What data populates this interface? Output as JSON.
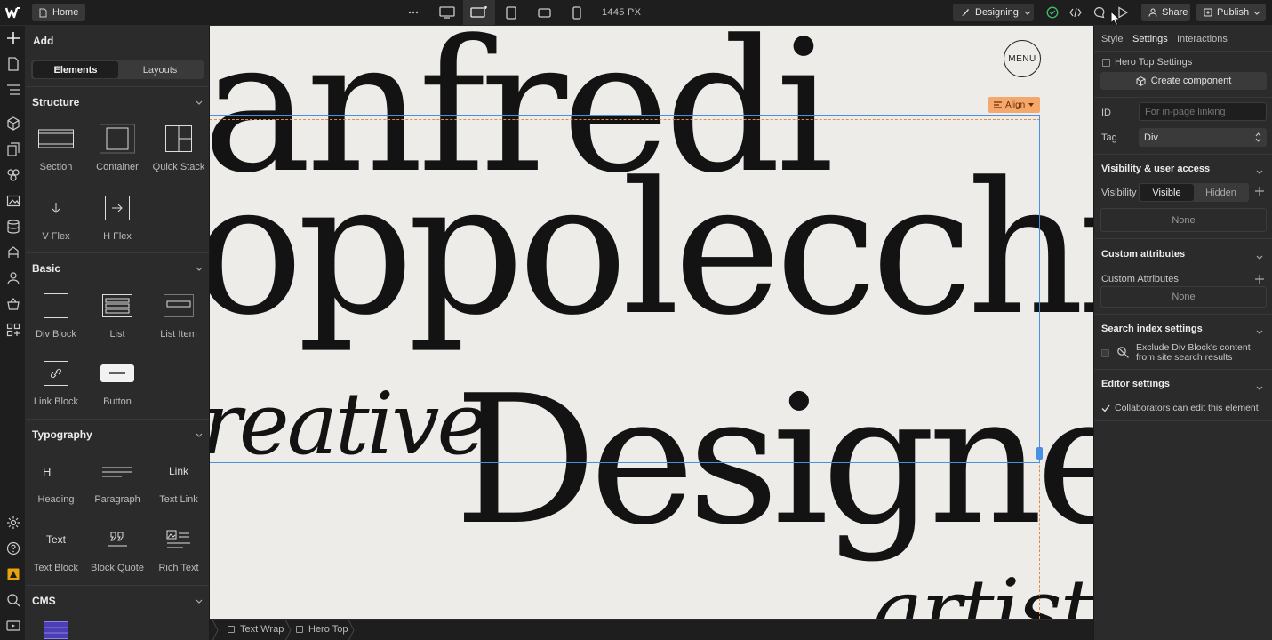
{
  "topbar": {
    "home_label": "Home",
    "width_label": "1445 PX",
    "mode_label": "Designing",
    "share_label": "Share",
    "publish_label": "Publish"
  },
  "add_panel": {
    "title": "Add",
    "tabs": [
      "Elements",
      "Layouts"
    ],
    "sections": {
      "structure": {
        "title": "Structure",
        "items": [
          "Section",
          "Container",
          "Quick Stack",
          "V Flex",
          "H Flex"
        ]
      },
      "basic": {
        "title": "Basic",
        "items": [
          "Div Block",
          "List",
          "List Item",
          "Link Block",
          "Button"
        ]
      },
      "typography": {
        "title": "Typography",
        "items": [
          "Heading",
          "Paragraph",
          "Text Link",
          "Text Block",
          "Block Quote",
          "Rich Text"
        ]
      },
      "cms": {
        "title": "CMS"
      }
    },
    "typography_glyphs": {
      "heading": "H",
      "text_link": "Link",
      "text_block": "Text"
    }
  },
  "canvas": {
    "line1": "anfredi",
    "line2": "oppolecchia",
    "line3": "reative",
    "line4": "Designer",
    "line5": "artist",
    "menu_label": "MENU",
    "align_label": "Align"
  },
  "breadcrumbs": [
    "Text Wrap",
    "Hero Top"
  ],
  "right_panel": {
    "tabs": [
      "Style",
      "Settings",
      "Interactions"
    ],
    "component_label": "Hero Top Settings",
    "create_component_label": "Create component",
    "id_label": "ID",
    "id_placeholder": "For in-page linking",
    "tag_label": "Tag",
    "tag_value": "Div",
    "visibility_header": "Visibility & user access",
    "visibility_label": "Visibility",
    "visibility_options": [
      "Visible",
      "Hidden"
    ],
    "visibility_none": "None",
    "custom_attr_header": "Custom attributes",
    "custom_attr_label": "Custom Attributes",
    "custom_attr_none": "None",
    "search_header": "Search index settings",
    "search_text": "Exclude Div Block's content from site search results",
    "editor_header": "Editor settings",
    "editor_text": "Collaborators can edit this element"
  },
  "colors": {
    "canvas_bg": "#eeece8",
    "selection_blue": "#4a90e2",
    "guide_orange": "#e08a4a",
    "align_tag": "#f5a86b",
    "status_green": "#3fbf6f"
  }
}
